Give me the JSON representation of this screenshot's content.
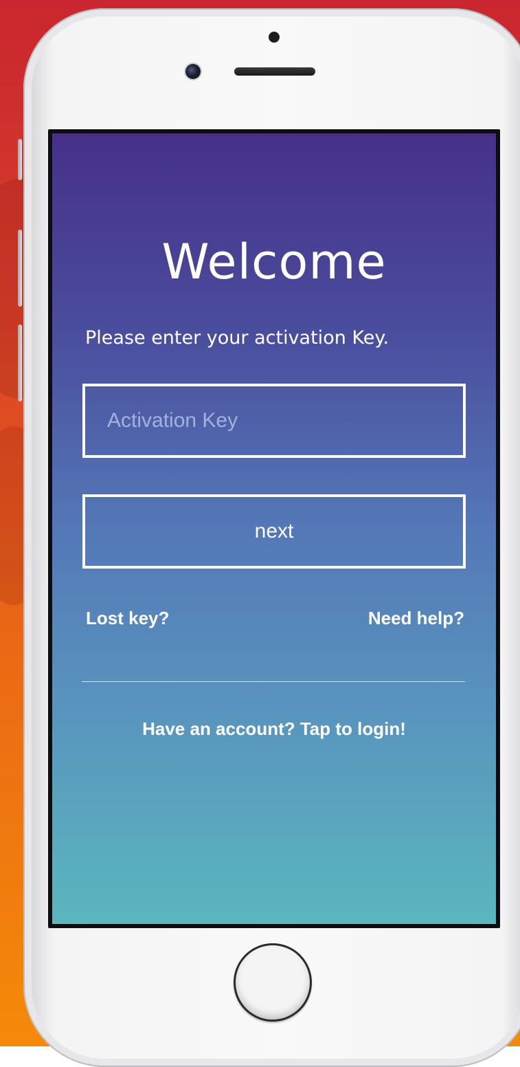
{
  "colors": {
    "background_top": "#c9262f",
    "background_bottom": "#f58a09",
    "screen_top": "#46308a",
    "screen_bottom": "#5bb6be",
    "text": "#ffffff"
  },
  "icons": {
    "front_camera": "front-camera-icon",
    "proximity_sensor": "sensor-dot-icon",
    "earpiece": "speaker-grille-icon",
    "home_button": "home-button-icon"
  },
  "screen": {
    "title": "Welcome",
    "subtitle": "Please enter your activation Key.",
    "activation_input": {
      "placeholder": "Activation Key",
      "value": ""
    },
    "next_button_label": "next",
    "lost_key_label": "Lost key?",
    "need_help_label": "Need help?",
    "login_prompt": "Have an account? Tap to login!"
  }
}
